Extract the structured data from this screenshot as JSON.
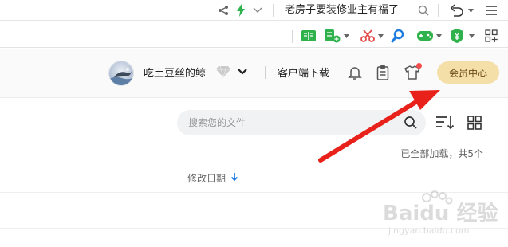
{
  "titlebar": {
    "icons": [
      "share-icon",
      "lightning-icon",
      "chevron-down-icon",
      "search-icon",
      "undo-icon",
      "menu-icon"
    ],
    "news_text": "老房子要装修业主有福了"
  },
  "extbar": {
    "icons": [
      "reader-icon",
      "add-app-icon",
      "scissors-icon",
      "search-icon",
      "gamepad-icon",
      "shield-yen-icon",
      "apps-icon"
    ]
  },
  "header": {
    "username": "吃土豆丝的鲸",
    "client_download": "客户端下载",
    "vip_center": "会员中心",
    "icons": [
      "bell-icon",
      "clipboard-icon",
      "tshirt-icon"
    ]
  },
  "files": {
    "search_placeholder": "搜索您的文件",
    "load_status": "已全部加载，共5个",
    "column_modified": "修改日期",
    "rows": [
      {
        "modified": "-"
      },
      {
        "modified": "-"
      }
    ]
  },
  "watermark": {
    "brand": "Baidu 经验",
    "url": "jingyan.baidu.com"
  },
  "colors": {
    "vip_button_bg": "#f5dfa8",
    "vip_button_text": "#6b4a16",
    "annotation_arrow": "#e8221b",
    "ext_green": "#2fb24c",
    "ext_red": "#e44b4b",
    "ext_blue": "#1e7be0"
  }
}
